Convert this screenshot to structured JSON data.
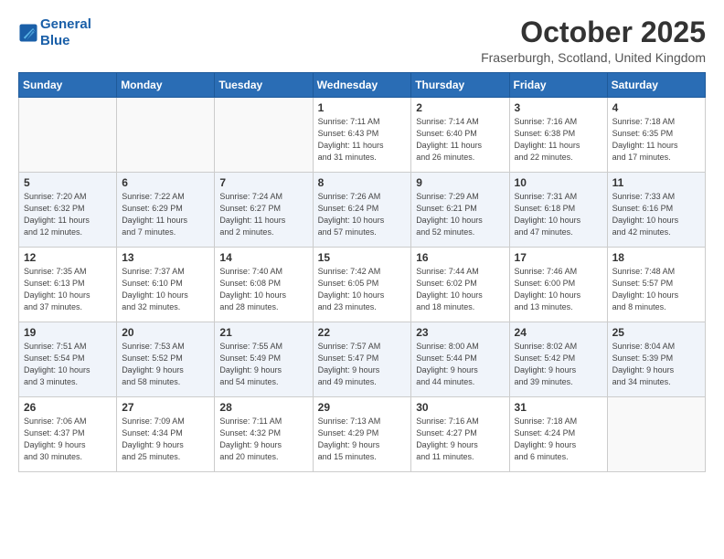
{
  "logo": {
    "line1": "General",
    "line2": "Blue"
  },
  "title": "October 2025",
  "location": "Fraserburgh, Scotland, United Kingdom",
  "weekdays": [
    "Sunday",
    "Monday",
    "Tuesday",
    "Wednesday",
    "Thursday",
    "Friday",
    "Saturday"
  ],
  "weeks": [
    [
      {
        "day": "",
        "info": ""
      },
      {
        "day": "",
        "info": ""
      },
      {
        "day": "",
        "info": ""
      },
      {
        "day": "1",
        "info": "Sunrise: 7:11 AM\nSunset: 6:43 PM\nDaylight: 11 hours\nand 31 minutes."
      },
      {
        "day": "2",
        "info": "Sunrise: 7:14 AM\nSunset: 6:40 PM\nDaylight: 11 hours\nand 26 minutes."
      },
      {
        "day": "3",
        "info": "Sunrise: 7:16 AM\nSunset: 6:38 PM\nDaylight: 11 hours\nand 22 minutes."
      },
      {
        "day": "4",
        "info": "Sunrise: 7:18 AM\nSunset: 6:35 PM\nDaylight: 11 hours\nand 17 minutes."
      }
    ],
    [
      {
        "day": "5",
        "info": "Sunrise: 7:20 AM\nSunset: 6:32 PM\nDaylight: 11 hours\nand 12 minutes."
      },
      {
        "day": "6",
        "info": "Sunrise: 7:22 AM\nSunset: 6:29 PM\nDaylight: 11 hours\nand 7 minutes."
      },
      {
        "day": "7",
        "info": "Sunrise: 7:24 AM\nSunset: 6:27 PM\nDaylight: 11 hours\nand 2 minutes."
      },
      {
        "day": "8",
        "info": "Sunrise: 7:26 AM\nSunset: 6:24 PM\nDaylight: 10 hours\nand 57 minutes."
      },
      {
        "day": "9",
        "info": "Sunrise: 7:29 AM\nSunset: 6:21 PM\nDaylight: 10 hours\nand 52 minutes."
      },
      {
        "day": "10",
        "info": "Sunrise: 7:31 AM\nSunset: 6:18 PM\nDaylight: 10 hours\nand 47 minutes."
      },
      {
        "day": "11",
        "info": "Sunrise: 7:33 AM\nSunset: 6:16 PM\nDaylight: 10 hours\nand 42 minutes."
      }
    ],
    [
      {
        "day": "12",
        "info": "Sunrise: 7:35 AM\nSunset: 6:13 PM\nDaylight: 10 hours\nand 37 minutes."
      },
      {
        "day": "13",
        "info": "Sunrise: 7:37 AM\nSunset: 6:10 PM\nDaylight: 10 hours\nand 32 minutes."
      },
      {
        "day": "14",
        "info": "Sunrise: 7:40 AM\nSunset: 6:08 PM\nDaylight: 10 hours\nand 28 minutes."
      },
      {
        "day": "15",
        "info": "Sunrise: 7:42 AM\nSunset: 6:05 PM\nDaylight: 10 hours\nand 23 minutes."
      },
      {
        "day": "16",
        "info": "Sunrise: 7:44 AM\nSunset: 6:02 PM\nDaylight: 10 hours\nand 18 minutes."
      },
      {
        "day": "17",
        "info": "Sunrise: 7:46 AM\nSunset: 6:00 PM\nDaylight: 10 hours\nand 13 minutes."
      },
      {
        "day": "18",
        "info": "Sunrise: 7:48 AM\nSunset: 5:57 PM\nDaylight: 10 hours\nand 8 minutes."
      }
    ],
    [
      {
        "day": "19",
        "info": "Sunrise: 7:51 AM\nSunset: 5:54 PM\nDaylight: 10 hours\nand 3 minutes."
      },
      {
        "day": "20",
        "info": "Sunrise: 7:53 AM\nSunset: 5:52 PM\nDaylight: 9 hours\nand 58 minutes."
      },
      {
        "day": "21",
        "info": "Sunrise: 7:55 AM\nSunset: 5:49 PM\nDaylight: 9 hours\nand 54 minutes."
      },
      {
        "day": "22",
        "info": "Sunrise: 7:57 AM\nSunset: 5:47 PM\nDaylight: 9 hours\nand 49 minutes."
      },
      {
        "day": "23",
        "info": "Sunrise: 8:00 AM\nSunset: 5:44 PM\nDaylight: 9 hours\nand 44 minutes."
      },
      {
        "day": "24",
        "info": "Sunrise: 8:02 AM\nSunset: 5:42 PM\nDaylight: 9 hours\nand 39 minutes."
      },
      {
        "day": "25",
        "info": "Sunrise: 8:04 AM\nSunset: 5:39 PM\nDaylight: 9 hours\nand 34 minutes."
      }
    ],
    [
      {
        "day": "26",
        "info": "Sunrise: 7:06 AM\nSunset: 4:37 PM\nDaylight: 9 hours\nand 30 minutes."
      },
      {
        "day": "27",
        "info": "Sunrise: 7:09 AM\nSunset: 4:34 PM\nDaylight: 9 hours\nand 25 minutes."
      },
      {
        "day": "28",
        "info": "Sunrise: 7:11 AM\nSunset: 4:32 PM\nDaylight: 9 hours\nand 20 minutes."
      },
      {
        "day": "29",
        "info": "Sunrise: 7:13 AM\nSunset: 4:29 PM\nDaylight: 9 hours\nand 15 minutes."
      },
      {
        "day": "30",
        "info": "Sunrise: 7:16 AM\nSunset: 4:27 PM\nDaylight: 9 hours\nand 11 minutes."
      },
      {
        "day": "31",
        "info": "Sunrise: 7:18 AM\nSunset: 4:24 PM\nDaylight: 9 hours\nand 6 minutes."
      },
      {
        "day": "",
        "info": ""
      }
    ]
  ]
}
